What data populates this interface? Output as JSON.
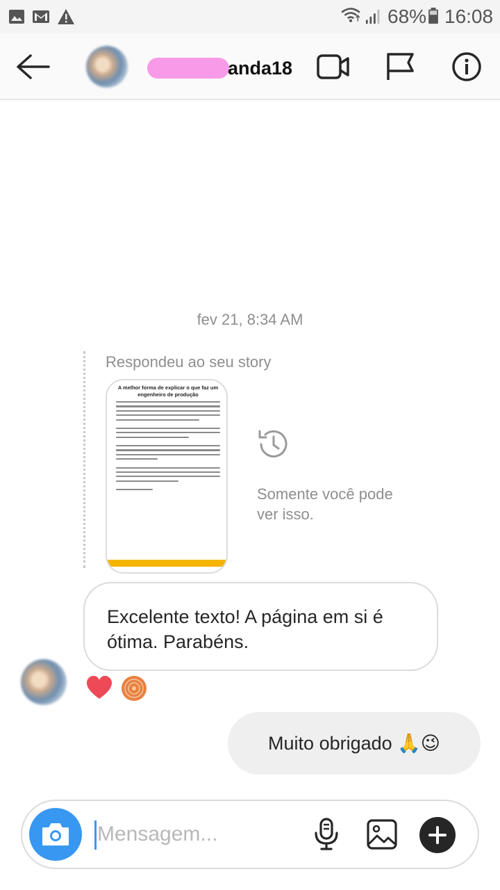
{
  "status_bar": {
    "battery": "68%",
    "time": "16:08",
    "icons": [
      "gallery-icon",
      "gmail-icon",
      "warning-icon",
      "wifi-icon",
      "signal-icon",
      "battery-icon"
    ]
  },
  "header": {
    "username": "anda18",
    "icons": [
      "back-arrow-icon",
      "video-call-icon",
      "flag-icon",
      "info-icon"
    ]
  },
  "conversation": {
    "timestamp": "fev 21, 8:34 AM",
    "reply_label": "Respondeu ao seu story",
    "story": {
      "title": "A melhor forma de explicar o que faz um engenheiro de produção"
    },
    "only_you_text": "Somente você pode ver isso.",
    "incoming_message": "Excelente texto! A página em si é ótima. Parabéns.",
    "reactions": [
      "heart-emoji",
      "profile-reaction"
    ],
    "outgoing_message": "Muito obrigado 🙏😉"
  },
  "composer": {
    "placeholder": "Mensagem...",
    "value": "",
    "icons": [
      "camera-icon",
      "microphone-icon",
      "gallery-icon",
      "add-icon"
    ]
  },
  "colors": {
    "accent": "#3897f0",
    "heart": "#ed4956",
    "redaction": "#f79ae7",
    "story_footer": "#f4b400"
  }
}
